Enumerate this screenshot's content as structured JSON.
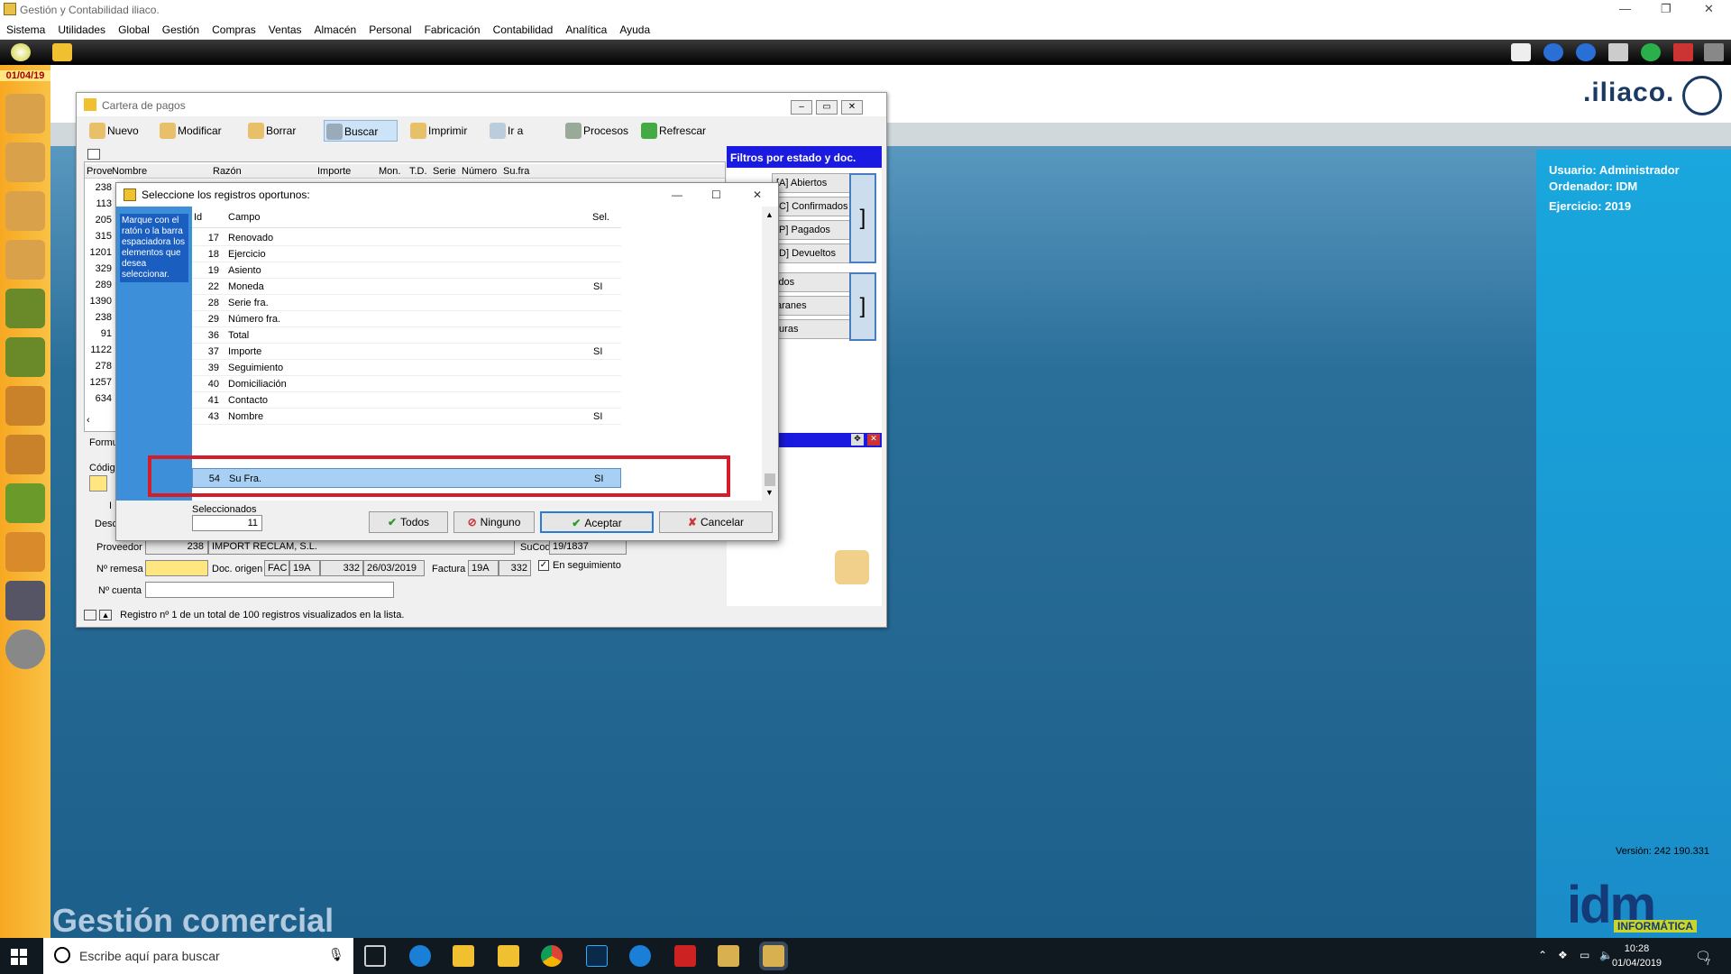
{
  "window": {
    "title": "Gestión y Contabilidad iliaco."
  },
  "menu": [
    "Sistema",
    "Utilidades",
    "Global",
    "Gestión",
    "Compras",
    "Ventas",
    "Almacén",
    "Personal",
    "Fabricación",
    "Contabilidad",
    "Analítica",
    "Ayuda"
  ],
  "sidebar": {
    "date": "01/04/19"
  },
  "brand": {
    "logo": ".iliaco.",
    "footer_title": "Gestión comercial",
    "version": "Versión: 242 190.331",
    "idm": "idm",
    "idm_sub": "INFORMÁTICA"
  },
  "user_panel": {
    "usuario": "Usuario: Administrador",
    "ordenador": "Ordenador: IDM",
    "ejercicio": "Ejercicio: 2019"
  },
  "cartera": {
    "title": "Cartera de pagos",
    "toolbar": [
      "Nuevo",
      "Modificar",
      "Borrar",
      "Buscar",
      "Imprimir",
      "Ir a",
      "Procesos",
      "Refrescar"
    ],
    "active_tool": "Buscar",
    "grid_headers": [
      "Prove",
      "Nombre",
      "Razón",
      "Importe",
      "Mon.",
      "T.D.",
      "Serie",
      "Número",
      "Su.fra"
    ],
    "left_ids": [
      "238",
      "113",
      "205",
      "315",
      "1201",
      "329",
      "289",
      "1390",
      "238",
      "91",
      "1122",
      "278",
      "1257",
      "634"
    ],
    "filters_title": "Filtros por estado y doc.",
    "filters": [
      "[A] Abiertos",
      "[C] Confirmados",
      "[P] Pagados",
      "[D] Devueltos",
      "idos",
      "aranes",
      "turas"
    ],
    "form": {
      "formu_label": "Formu",
      "codigo_label": "Códig",
      "i_label": "I",
      "desc_label": "Desc",
      "proveedor_label": "Proveedor",
      "proveedor_code": "238",
      "proveedor_name": "IMPORT RECLAM, S.L.",
      "sucod_label": "SuCod",
      "sucod_value": "19/1837",
      "remesa_label": "Nº remesa",
      "doc_origen_label": "Doc. origen",
      "doc_tipo": "FAC",
      "doc_serie": "19A",
      "doc_num": "332",
      "doc_fecha": "26/03/2019",
      "factura_label": "Factura",
      "factura_serie": "19A",
      "factura_num": "332",
      "seguimiento_label": "En seguimiento",
      "cuenta_label": "Nº cuenta"
    },
    "status": "Registro nº 1 de un total de 100 registros visualizados en la lista."
  },
  "dialog": {
    "title": "Seleccione los registros oportunos:",
    "hint": "Marque con el ratón o la barra espaciadora los elementos que desea seleccionar.",
    "headers": {
      "id": "Id",
      "campo": "Campo",
      "sel": "Sel."
    },
    "rows": [
      {
        "id": "17",
        "campo": "Renovado",
        "sel": ""
      },
      {
        "id": "18",
        "campo": "Ejercicio",
        "sel": ""
      },
      {
        "id": "19",
        "campo": "Asiento",
        "sel": ""
      },
      {
        "id": "22",
        "campo": "Moneda",
        "sel": "SI"
      },
      {
        "id": "28",
        "campo": "Serie fra.",
        "sel": ""
      },
      {
        "id": "29",
        "campo": "Número fra.",
        "sel": ""
      },
      {
        "id": "36",
        "campo": "Total",
        "sel": ""
      },
      {
        "id": "37",
        "campo": "Importe",
        "sel": "SI"
      },
      {
        "id": "39",
        "campo": "Seguimiento",
        "sel": ""
      },
      {
        "id": "40",
        "campo": "Domiciliación",
        "sel": ""
      },
      {
        "id": "41",
        "campo": "Contacto",
        "sel": ""
      },
      {
        "id": "43",
        "campo": "Nombre",
        "sel": "SI"
      }
    ],
    "selected_row": {
      "id": "54",
      "campo": "Su Fra.",
      "sel": "SI"
    },
    "seleccionados_label": "Seleccionados",
    "seleccionados_value": "11",
    "buttons": {
      "todos": "Todos",
      "ninguno": "Ninguno",
      "aceptar": "Aceptar",
      "cancelar": "Cancelar"
    }
  },
  "taskbar": {
    "search_placeholder": "Escribe aquí para buscar",
    "time": "10:28",
    "date": "01/04/2019",
    "notif": "7"
  },
  "colors": {
    "sidebar": "#f7a822",
    "panel_blue": "#19a7de",
    "highlight": "#d51c2a",
    "filters_header": "#1a1ae0"
  }
}
